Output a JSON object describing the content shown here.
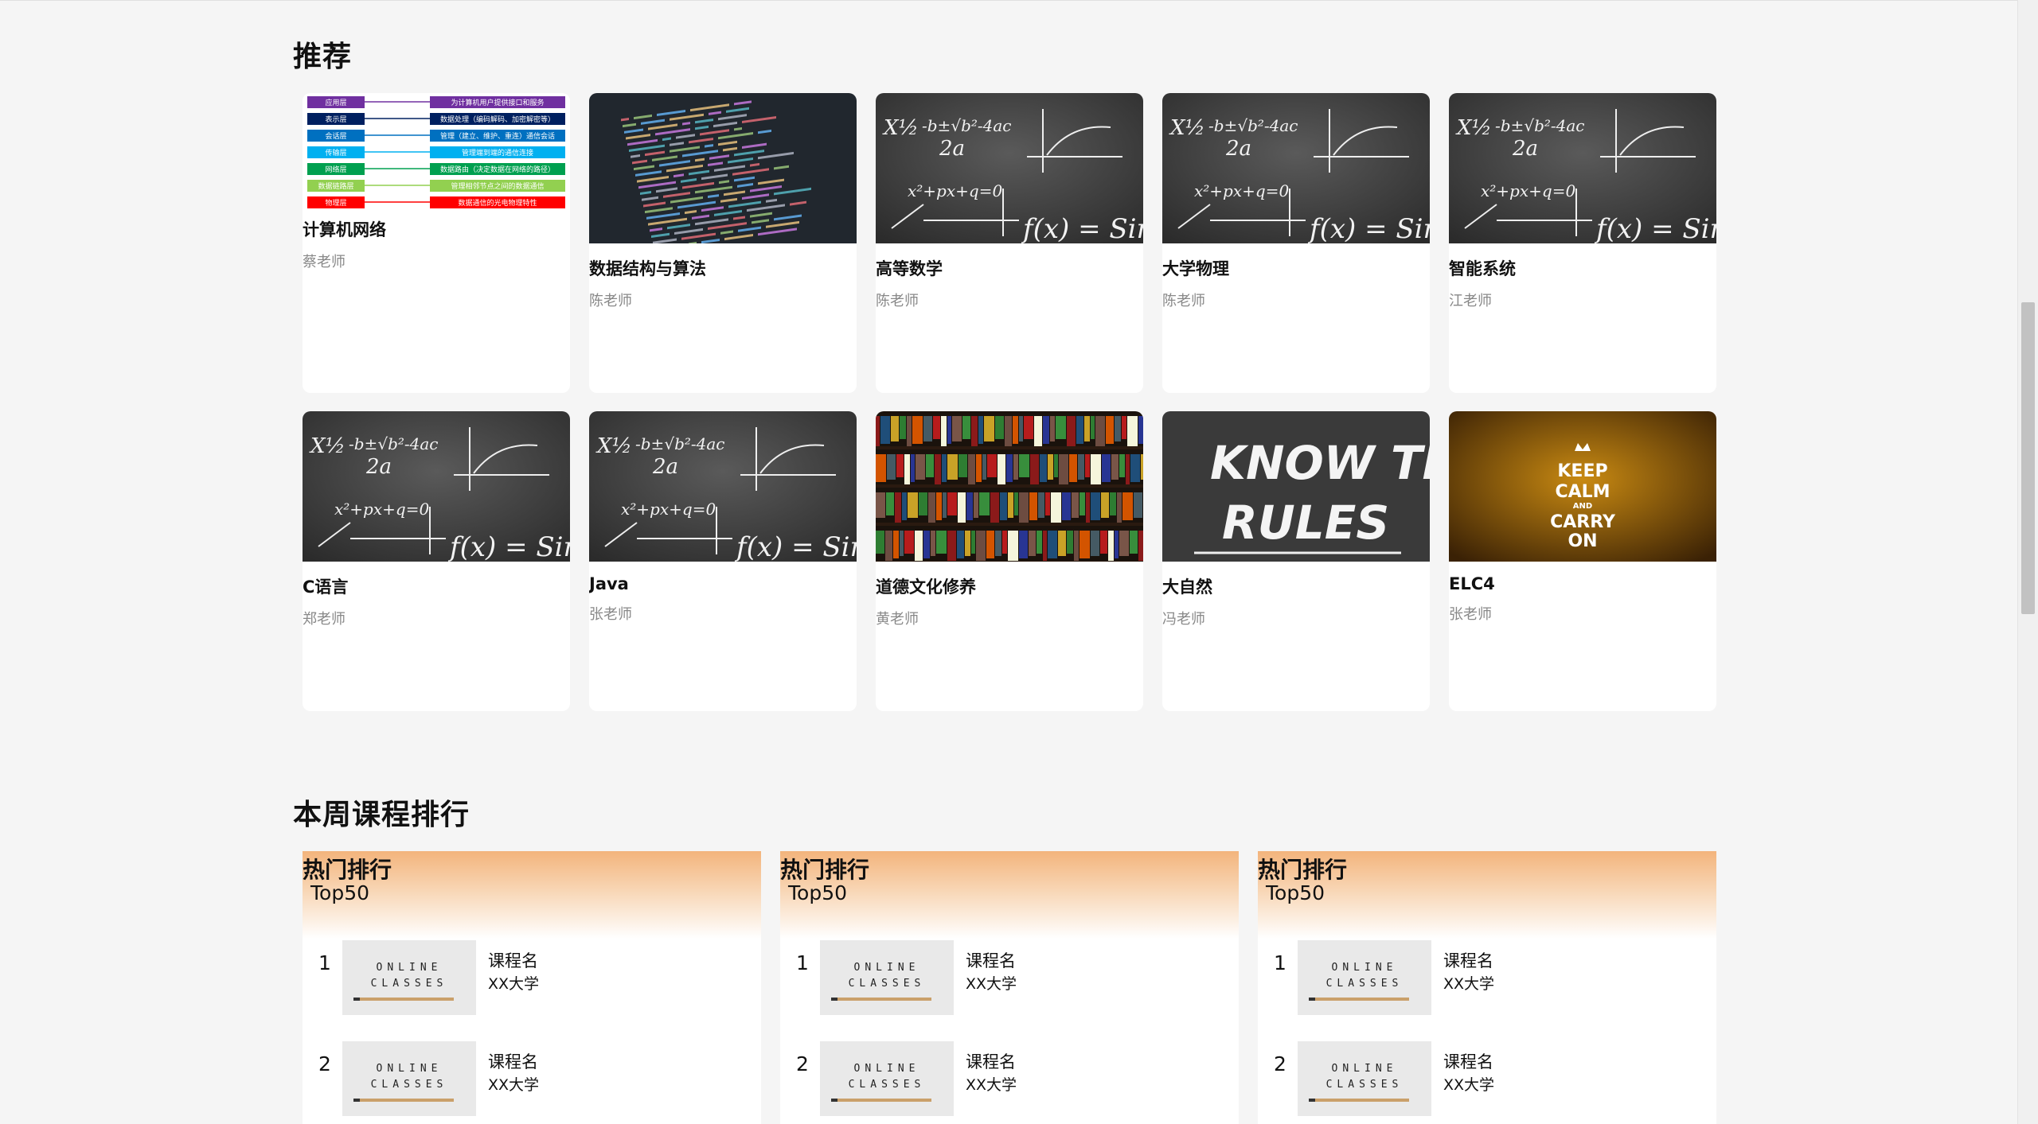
{
  "recommend": {
    "title": "推荐",
    "courses": [
      {
        "name": "计算机网络",
        "teacher": "蔡老师",
        "cover": "network-layers-diagram"
      },
      {
        "name": "数据结构与算法",
        "teacher": "陈老师",
        "cover": "code-screen"
      },
      {
        "name": "高等数学",
        "teacher": "陈老师",
        "cover": "math-chalkboard"
      },
      {
        "name": "大学物理",
        "teacher": "陈老师",
        "cover": "math-chalkboard"
      },
      {
        "name": "智能系统",
        "teacher": "江老师",
        "cover": "math-chalkboard"
      },
      {
        "name": "C语言",
        "teacher": "郑老师",
        "cover": "math-chalkboard"
      },
      {
        "name": "Java",
        "teacher": "张老师",
        "cover": "math-chalkboard"
      },
      {
        "name": "道德文化修养",
        "teacher": "黄老师",
        "cover": "bookshelf"
      },
      {
        "name": "大自然",
        "teacher": "冯老师",
        "cover": "know-the-rules-chalkboard"
      },
      {
        "name": "ELC4",
        "teacher": "张老师",
        "cover": "keep-calm-poster"
      }
    ],
    "network_layers": [
      {
        "layer": "应用层",
        "desc": "为计算机用户提供接口和服务",
        "color": "#7030a0"
      },
      {
        "layer": "表示层",
        "desc": "数据处理（编码解码、加密解密等）",
        "color": "#002060"
      },
      {
        "layer": "会话层",
        "desc": "管理（建立、维护、重连）通信会话",
        "color": "#0070c0"
      },
      {
        "layer": "传输层",
        "desc": "管理端到端的通信连接",
        "color": "#00b0f0"
      },
      {
        "layer": "网络层",
        "desc": "数据路由（决定数据在网络的路径）",
        "color": "#00a050"
      },
      {
        "layer": "数据链路层",
        "desc": "管理相邻节点之间的数据通信",
        "color": "#92d050"
      },
      {
        "layer": "物理层",
        "desc": "数据通信的光电物理特性",
        "color": "#ff0000"
      }
    ],
    "chalk_text": {
      "formula": "X½ = -b±√b²-4ac / 2a",
      "fx": "f(x) = Sin x",
      "rules": [
        "KNOW THE",
        "RULES"
      ]
    },
    "poster_text": [
      "KEEP",
      "CALM",
      "AND",
      "CARRY",
      "ON"
    ]
  },
  "weekly_rank": {
    "title": "本周课程排行",
    "panels": [
      {
        "title": "热门排行",
        "subtitle": "Top50",
        "items": [
          {
            "rank": "1",
            "name": "课程名",
            "school": "XX大学"
          },
          {
            "rank": "2",
            "name": "课程名",
            "school": "XX大学"
          }
        ]
      },
      {
        "title": "热门排行",
        "subtitle": "Top50",
        "items": [
          {
            "rank": "1",
            "name": "课程名",
            "school": "XX大学"
          },
          {
            "rank": "2",
            "name": "课程名",
            "school": "XX大学"
          }
        ]
      },
      {
        "title": "热门排行",
        "subtitle": "Top50",
        "items": [
          {
            "rank": "1",
            "name": "课程名",
            "school": "XX大学"
          },
          {
            "rank": "2",
            "name": "课程名",
            "school": "XX大学"
          }
        ]
      }
    ],
    "thumb_text": [
      "ONLINE",
      "CLASSES"
    ]
  }
}
